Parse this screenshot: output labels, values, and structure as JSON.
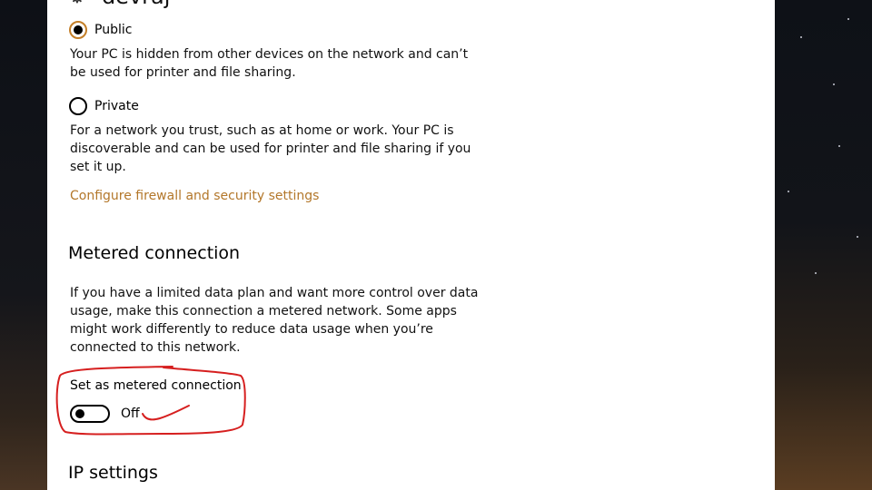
{
  "network": {
    "name": "devraj",
    "icon": "gear-icon"
  },
  "profile": {
    "public_label": "Public",
    "public_desc": "Your PC is hidden from other devices on the network and can’t be used for printer and file sharing.",
    "private_label": "Private",
    "private_desc": "For a network you trust, such as at home or work. Your PC is discoverable and can be used for printer and file sharing if you set it up.",
    "selected": "Public",
    "firewall_link": "Configure firewall and security settings"
  },
  "metered": {
    "title": "Metered connection",
    "desc": "If you have a limited data plan and want more control over data usage, make this connection a metered network. Some apps might work differently to reduce data usage when you’re connected to this network.",
    "toggle_label": "Set as metered connection",
    "toggle_state": "Off"
  },
  "ip_settings": {
    "title": "IP settings"
  },
  "colors": {
    "accent": "#c47f28",
    "link": "#b3772a",
    "annotation": "#d61f1f"
  }
}
